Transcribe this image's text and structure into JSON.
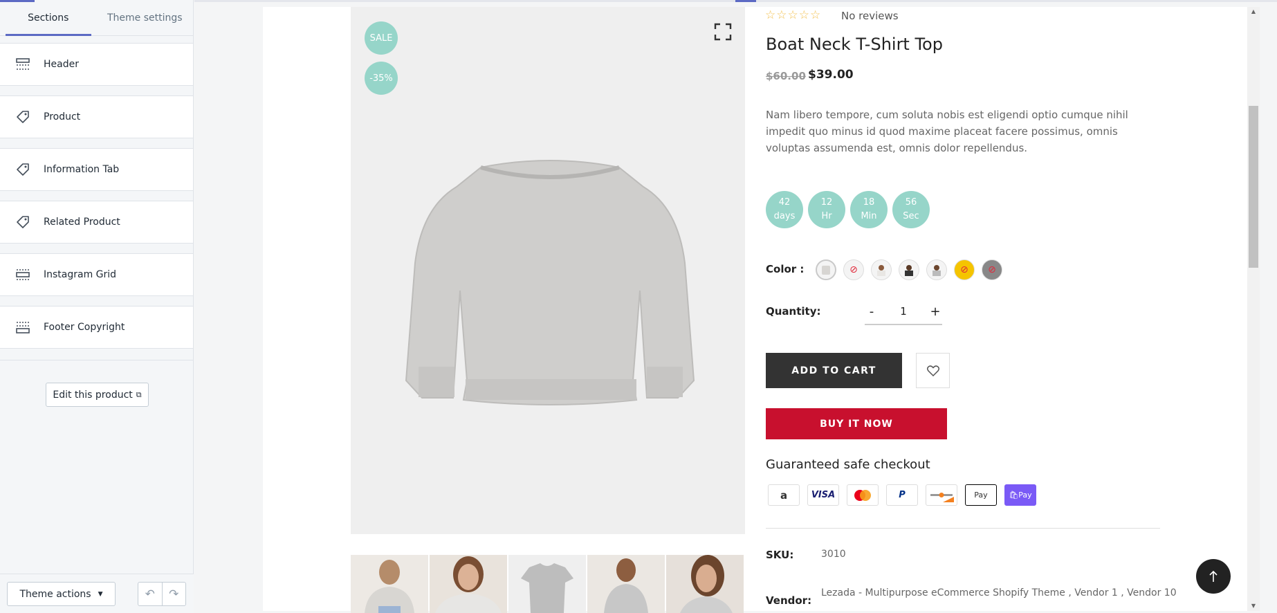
{
  "sidebar": {
    "tabs": [
      {
        "label": "Sections",
        "active": true
      },
      {
        "label": "Theme settings",
        "active": false
      }
    ],
    "sections": [
      {
        "label": "Header",
        "icon": "header-layout-icon"
      },
      {
        "label": "Product",
        "icon": "tag-icon"
      },
      {
        "label": "Information Tab",
        "icon": "tag-icon"
      },
      {
        "label": "Related Product",
        "icon": "tag-icon"
      },
      {
        "label": "Instagram Grid",
        "icon": "grid-layout-icon"
      },
      {
        "label": "Footer Copyright",
        "icon": "footer-layout-icon"
      }
    ],
    "edit_product_label": "Edit this product",
    "theme_actions_label": "Theme actions"
  },
  "product": {
    "badges": {
      "sale": "SALE",
      "discount": "-35%"
    },
    "rating_stars": "☆☆☆☆☆",
    "reviews": "No reviews",
    "title": "Boat Neck T-Shirt Top",
    "price_old": "$60.00",
    "price_new": "$39.00",
    "description": "Nam libero tempore, cum soluta nobis est eligendi optio cumque nihil impedit quo minus id quod maxime placeat facere possimus, omnis voluptas assumenda est, omnis dolor repellendus.",
    "countdown": [
      {
        "value": "42",
        "unit": "days"
      },
      {
        "value": "12",
        "unit": "Hr"
      },
      {
        "value": "18",
        "unit": "Min"
      },
      {
        "value": "56",
        "unit": "Sec"
      }
    ],
    "color_label": "Color :",
    "swatch_count": 7,
    "quantity_label": "Quantity:",
    "quantity_minus": "-",
    "quantity_value": "1",
    "quantity_plus": "+",
    "add_to_cart": "ADD TO CART",
    "buy_now": "BUY IT NOW",
    "guaranteed": "Guaranteed safe checkout",
    "payment_methods": [
      "a",
      "VISA",
      "",
      "P",
      "",
      "Pay",
      "Pay"
    ],
    "sku_label": "SKU:",
    "sku_value": "3010",
    "vendor_label": "Vendor:",
    "vendor_value": "Lezada - Multipurpose eCommerce Shopify Theme , Vendor 1 , Vendor 10"
  },
  "colors": {
    "accent": "#5c6ac4",
    "badge": "#96d5c9",
    "buy_now": "#c8102e",
    "add_to_cart": "#333333",
    "star": "#f3c14f"
  }
}
